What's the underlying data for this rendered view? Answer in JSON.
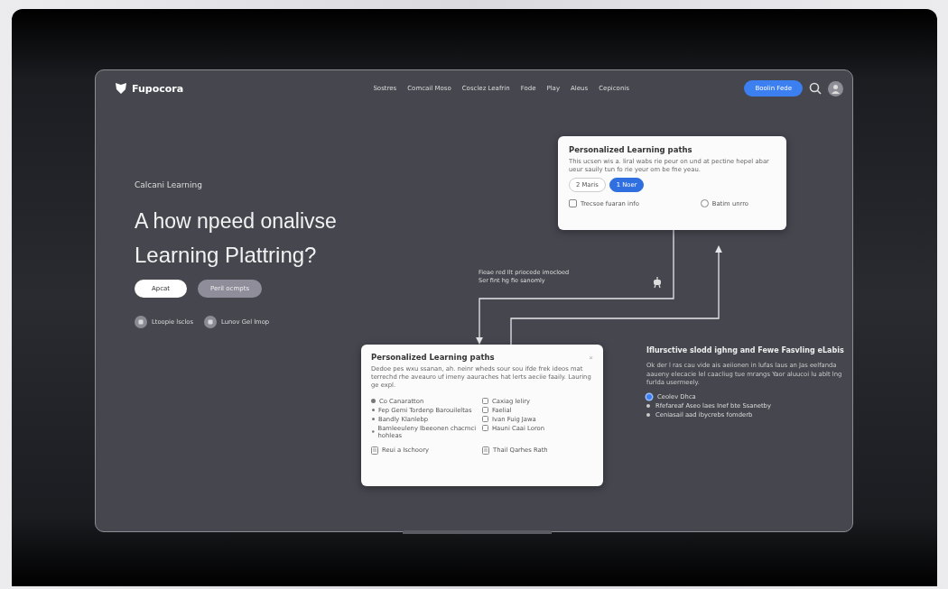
{
  "nav": {
    "logo": "Fupocora",
    "links": [
      "Sostres",
      "Comcail Moso",
      "Cosclez Leafrin",
      "Fode",
      "Play",
      "Aleus",
      "Cepiconis"
    ],
    "cta": "Boolin Fede"
  },
  "hero": {
    "eyebrow": "Calcani Learning",
    "title_lines": [
      "A how npeed onalivse",
      "Learning Plattring?"
    ],
    "buttons": [
      {
        "label": "Apcat",
        "kind": "primary"
      },
      {
        "label": "Peril ocmpts",
        "kind": "secondary"
      }
    ],
    "features": [
      "Ltoopie lsclos",
      "Lunov Gel lmop"
    ]
  },
  "top_card": {
    "title": "Personalized Learning paths",
    "description": "This ucsen wis a. liral wabs rie peur on und at pectine hepel abar ueur sauily tun fo rie yeur om be fne yeau.",
    "chips": [
      {
        "label": "2 Maris",
        "selected": false
      },
      {
        "label": "1 Noer",
        "selected": true
      }
    ],
    "options": [
      {
        "label": "Trecsoe fuaran info",
        "kind": "checkbox"
      },
      {
        "label": "Batim unrro",
        "kind": "radio"
      }
    ]
  },
  "flow_note": {
    "lines": [
      "Fieae red Ilt priocede imocloed",
      "Ser fint hg fie sanomly"
    ]
  },
  "bottom_card": {
    "title": "Personalized Learning paths",
    "close": "×",
    "description": "Dedoe pes wxu ssanan, ah. neinr wheds sour sou ifde frek ideos mat terrechd rhe aveauro uf imeny aauraches hat lerts aeciie faaily. Lauring ge expl.",
    "left_heading": "Co Canaratton",
    "left_items": [
      "Fep Gemi Tordenp Barouileltas",
      "Bandly Klanlebp",
      "Bamleeuleny Ibeeonen chacmci hohleas"
    ],
    "right_items": [
      "Caxiag leliry",
      "Faelial",
      "Ivan Fuig Jawa",
      "Hauni Caai Loron"
    ],
    "footer": [
      "Reui a Ischoory",
      "Thail Qarhes Rath"
    ]
  },
  "side": {
    "title": "Iflursctive slodd ighng and Fewe Fasvling eLabis",
    "description": "Ok der l ras cau vide ais aeiionen in lufas laus an Jas eelfanda aaueny elecacie lel caacliug tue mrangs Yaor aluucoi lu ablt lng furlda usermeely.",
    "items": [
      {
        "label": "Ceolev Dhca",
        "selected": true
      },
      {
        "label": "Rfefareaf Aseo laes Inef bte Ssanetby",
        "selected": false
      },
      {
        "label": "Ceniasail aad ibycrebs fomderb",
        "selected": false
      }
    ]
  }
}
